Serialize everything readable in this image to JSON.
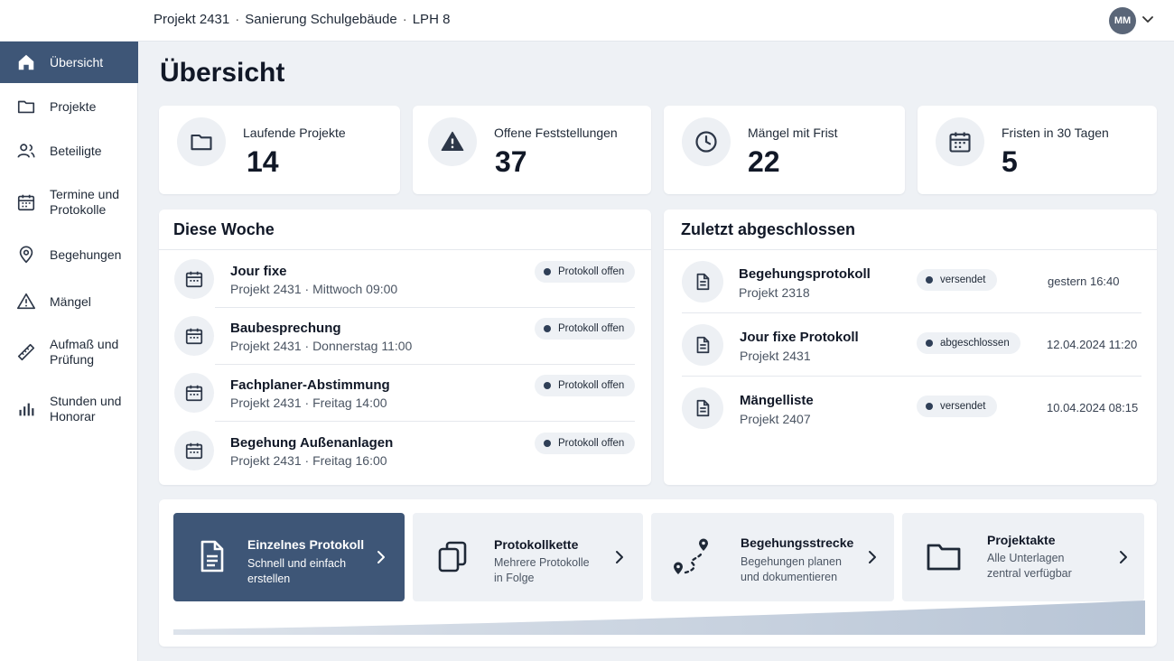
{
  "header": {
    "breadcrumb": [
      "Projekt 2431",
      "Sanierung Schulgebäude",
      "LPH 8"
    ],
    "separator": "·",
    "avatar_initials": "MM"
  },
  "sidebar": {
    "items": [
      {
        "label": "Übersicht",
        "icon": "home-icon",
        "active": true
      },
      {
        "label": "Projekte",
        "icon": "folder-icon"
      },
      {
        "label": "Beteiligte",
        "icon": "users-icon"
      },
      {
        "label": "Termine und Protokolle",
        "icon": "calendar-icon"
      },
      {
        "label": "Begehungen",
        "icon": "map-pin-icon"
      },
      {
        "label": "Mängel",
        "icon": "warning-icon"
      },
      {
        "label": "Aufmaß und Prüfung",
        "icon": "ruler-icon"
      },
      {
        "label": "Stunden und Honorar",
        "icon": "bar-chart-icon"
      }
    ]
  },
  "page_title": "Übersicht",
  "stats": [
    {
      "label": "Laufende Projekte",
      "value": "14",
      "icon": "folder-icon"
    },
    {
      "label": "Offene Feststellungen",
      "value": "37",
      "icon": "warning-icon"
    },
    {
      "label": "Mängel mit Frist",
      "value": "22",
      "icon": "clock-icon"
    },
    {
      "label": "Fristen in 30 Tagen",
      "value": "5",
      "icon": "calendar-icon"
    }
  ],
  "this_week": {
    "title": "Diese Woche",
    "items": [
      {
        "title": "Jour fixe",
        "project": "Projekt 2431",
        "when": "Mittwoch 09:00",
        "status": "Protokoll offen"
      },
      {
        "title": "Baubesprechung",
        "project": "Projekt 2431",
        "when": "Donnerstag 11:00",
        "status": "Protokoll offen"
      },
      {
        "title": "Fachplaner-Abstimmung",
        "project": "Projekt 2431",
        "when": "Freitag 14:00",
        "status": "Protokoll offen"
      },
      {
        "title": "Begehung Außenanlagen",
        "project": "Projekt 2431",
        "when": "Freitag 16:00",
        "status": "Protokoll offen"
      }
    ]
  },
  "recently_done": {
    "title": "Zuletzt abgeschlossen",
    "items": [
      {
        "title": "Begehungsprotokoll",
        "project": "Projekt 2318",
        "status": "versendet",
        "date": "gestern 16:40"
      },
      {
        "title": "Jour fixe Protokoll",
        "project": "Projekt 2431",
        "status": "abgeschlossen",
        "date": "12.04.2024 11:20"
      },
      {
        "title": "Mängelliste",
        "project": "Projekt 2407",
        "status": "versendet",
        "date": "10.04.2024 08:15"
      }
    ]
  },
  "actions": [
    {
      "title": "Einzelnes Protokoll",
      "sub1": "Schnell und einfach",
      "sub2": "erstellen",
      "icon": "document-icon",
      "primary": true
    },
    {
      "title": "Protokollkette",
      "sub1": "Mehrere Protokolle",
      "sub2": "in Folge",
      "icon": "copy-icon"
    },
    {
      "title": "Begehungsstrecke",
      "sub1": "Begehungen planen",
      "sub2": "und dokumentieren",
      "icon": "route-icon"
    },
    {
      "title": "Projektakte",
      "sub1": "Alle Unterlagen",
      "sub2": "zentral verfügbar",
      "icon": "folder-icon"
    }
  ],
  "colors": {
    "accent": "#3e5677",
    "background": "#eef1f5",
    "card": "#ffffff"
  }
}
